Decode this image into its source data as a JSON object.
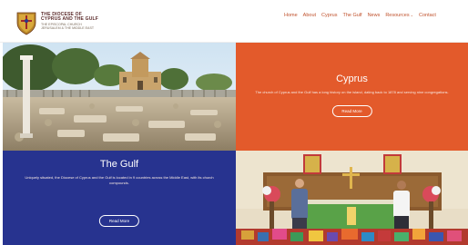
{
  "brand": {
    "line1": "THE DIOCESE OF",
    "line2": "CYPRUS AND THE GULF",
    "line3": "THE EPISCOPAL CHURCH",
    "line4": "JERUSALEM & THE MIDDLE EAST"
  },
  "nav": [
    {
      "label": "Home",
      "dropdown": false
    },
    {
      "label": "About",
      "dropdown": false
    },
    {
      "label": "Cyprus",
      "dropdown": false
    },
    {
      "label": "The Gulf",
      "dropdown": false
    },
    {
      "label": "News",
      "dropdown": false
    },
    {
      "label": "Resources",
      "dropdown": true
    },
    {
      "label": "Contact",
      "dropdown": false
    }
  ],
  "cyprus": {
    "title": "Cyprus",
    "text": "The church of Cyprus and the Gulf has a long history on the island, dating back to 1878 and serving nine congregations.",
    "button": "Read More"
  },
  "gulf": {
    "title": "The Gulf",
    "text": "Uniquely situated, the Diocese of Cyprus and the Gulf is located in 9 countries across the Middle East, with its church compounds.",
    "button": "Read More"
  },
  "colors": {
    "cyprus_bg": "#e35a2b",
    "gulf_bg": "#27338f",
    "nav_text": "#c0522d"
  },
  "icons": {
    "logo": "diocese-crest-icon",
    "dropdown": "caret-down-icon"
  }
}
